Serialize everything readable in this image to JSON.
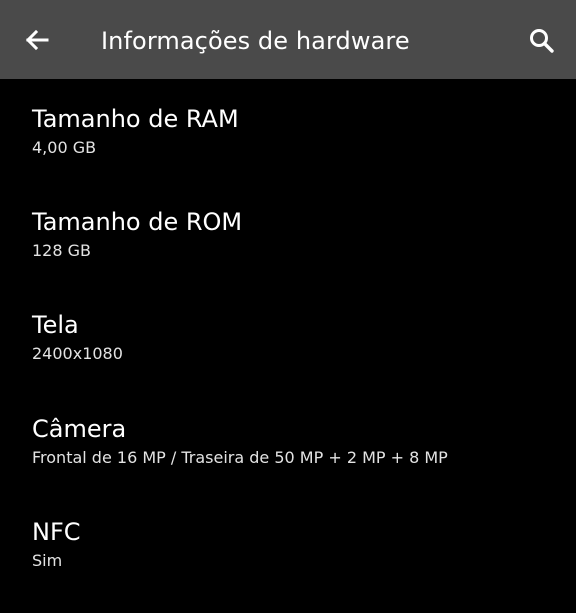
{
  "appbar": {
    "title": "Informações de hardware",
    "background": "#4a4a4a",
    "back_icon": "arrow-left-icon",
    "search_icon": "search-icon"
  },
  "items": [
    {
      "title": "Tamanho de RAM",
      "value": "4,00 GB"
    },
    {
      "title": "Tamanho de ROM",
      "value": "128 GB"
    },
    {
      "title": "Tela",
      "value": "2400x1080"
    },
    {
      "title": "Câmera",
      "value": "Frontal de 16 MP / Traseira de 50 MP + 2 MP + 8 MP"
    },
    {
      "title": "NFC",
      "value": "Sim"
    }
  ]
}
